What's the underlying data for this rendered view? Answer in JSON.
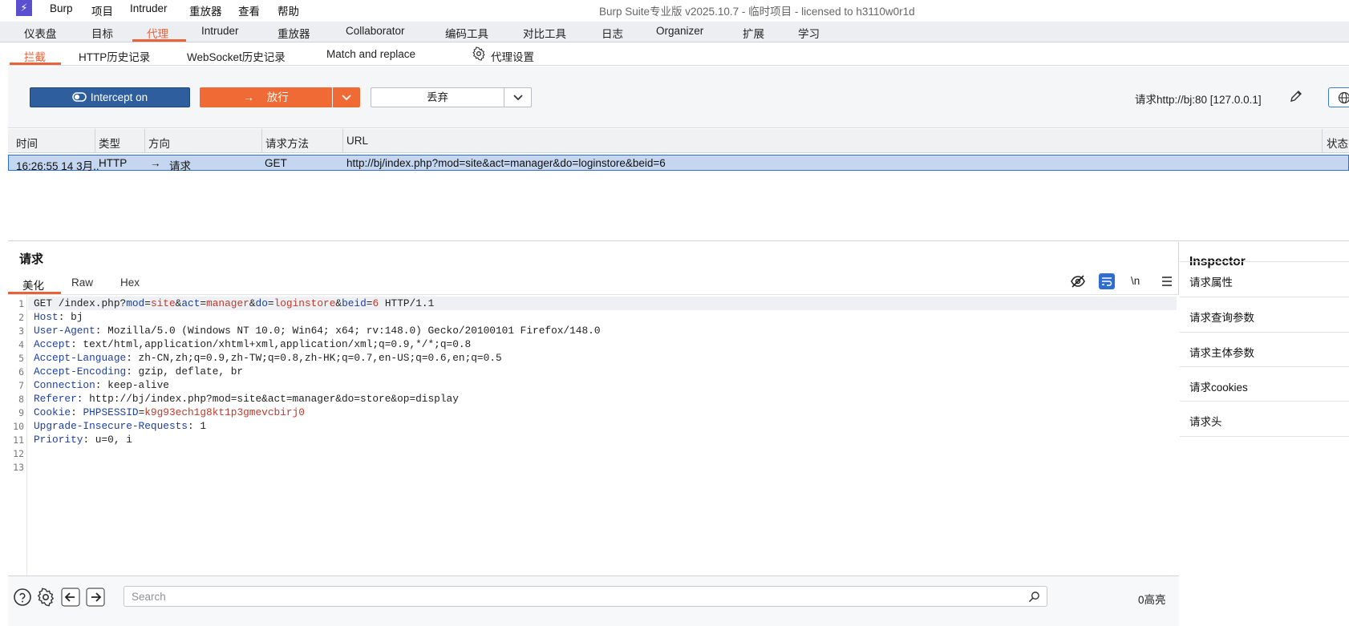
{
  "titlebar": {
    "logo": "⚡",
    "menus": [
      "Burp",
      "项目",
      "Intruder",
      "重放器",
      "查看",
      "帮助"
    ],
    "window_title": "Burp Suite专业版  v2025.10.7 - 临时项目 - licensed to h3110w0r1d"
  },
  "main_tabs": [
    "仪表盘",
    "目标",
    "代理",
    "Intruder",
    "重放器",
    "Collaborator",
    "编码工具",
    "对比工具",
    "日志",
    "Organizer",
    "扩展",
    "学习"
  ],
  "active_main_tab": "代理",
  "sub_tabs": [
    "拦截",
    "HTTP历史记录",
    "WebSocket历史记录",
    "Match and replace",
    "代理设置"
  ],
  "active_sub_tab": "拦截",
  "toolbar": {
    "intercept_label": "Intercept on",
    "forward_label": "放行",
    "drop_label": "丢弃",
    "request_info": "请求http://bj:80  [127.0.0.1]"
  },
  "table": {
    "columns": [
      "时间",
      "类型",
      "方向",
      "请求方法",
      "URL",
      "状态"
    ],
    "rows": [
      {
        "time": "16:26:55 14 3月..",
        "type": "HTTP",
        "direction": "请求",
        "method": "GET",
        "url": "http://bj/index.php?mod=site&act=manager&do=loginstore&beid=6"
      }
    ]
  },
  "request": {
    "title": "请求",
    "tabs": [
      "美化",
      "Raw",
      "Hex"
    ],
    "active_tab": "美化",
    "line_numbers": [
      "1",
      "2",
      "3",
      "4",
      "5",
      "6",
      "7",
      "8",
      "9",
      "10",
      "11",
      "12",
      "13"
    ],
    "lines": {
      "l1_method": "GET /index.php?",
      "l1_p1k": "mod",
      "l1_p1v": "site",
      "l1_p2k": "act",
      "l1_p2v": "manager",
      "l1_p3k": "do",
      "l1_p3v": "loginstore",
      "l1_p4k": "beid",
      "l1_p4v": "6",
      "l1_proto": " HTTP/1.1",
      "l2_k": "Host",
      "l2_v": ": bj",
      "l3_k": "User-Agent",
      "l3_v": ": Mozilla/5.0 (Windows NT 10.0; Win64; x64; rv:148.0) Gecko/20100101 Firefox/148.0",
      "l4_k": "Accept",
      "l4_v": ": text/html,application/xhtml+xml,application/xml;q=0.9,*/*;q=0.8",
      "l5_k": "Accept-Language",
      "l5_v": ": zh-CN,zh;q=0.9,zh-TW;q=0.8,zh-HK;q=0.7,en-US;q=0.6,en;q=0.5",
      "l6_k": "Accept-Encoding",
      "l6_v": ": gzip, deflate, br",
      "l7_k": "Connection",
      "l7_v": ": keep-alive",
      "l8_k": "Referer",
      "l8_v": ": http://bj/index.php?mod=site&act=manager&do=store&op=display",
      "l9_k": "Cookie",
      "l9_sep": ": ",
      "l9_ck": "PHPSESSID",
      "l9_cv": "k9g93ech1g8kt1p3gmevcbirj0",
      "l10_k": "Upgrade-Insecure-Requests",
      "l10_v": ": 1",
      "l11_k": "Priority",
      "l11_v": ": u=0, i"
    },
    "search_placeholder": "Search",
    "highlights": "0高亮",
    "newline_toggle": "\\n"
  },
  "inspector": {
    "title": "Inspector",
    "items": [
      "请求属性",
      "请求查询参数",
      "请求主体参数",
      "请求cookies",
      "请求头"
    ]
  },
  "colors": {
    "accent": "#e8633a",
    "intercept_blue": "#2e5e9e",
    "forward_orange": "#ef6a34",
    "selected_row": "#c5d7f0"
  }
}
